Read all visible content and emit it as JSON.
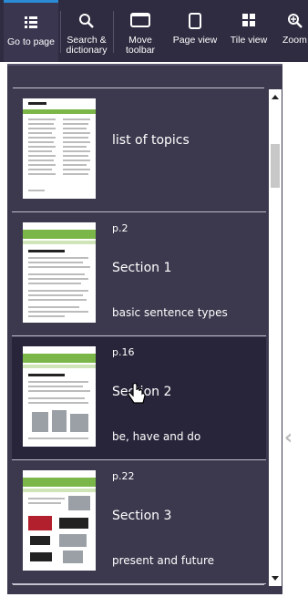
{
  "toolbar": {
    "items": [
      {
        "label_line1": "Go to page",
        "label_line2": "",
        "icon": "list-icon"
      },
      {
        "label_line1": "Search &",
        "label_line2": "dictionary",
        "icon": "search-icon"
      },
      {
        "label_line1": "Move",
        "label_line2": "toolbar",
        "icon": "window-icon"
      },
      {
        "label_line1": "Page view",
        "label_line2": "",
        "icon": "page-icon"
      },
      {
        "label_line1": "Tile view",
        "label_line2": "",
        "icon": "grid-icon"
      },
      {
        "label_line1": "Zoom",
        "label_line2": "",
        "icon": "zoom-icon"
      }
    ]
  },
  "pages": {
    "items": [
      {
        "page": "",
        "title": "list of topics",
        "subtitle": ""
      },
      {
        "page": "p.2",
        "title": "Section 1",
        "subtitle": "basic sentence types"
      },
      {
        "page": "p.16",
        "title": "Section 2",
        "subtitle": "be, have and do"
      },
      {
        "page": "p.22",
        "title": "Section 3",
        "subtitle": "present and future"
      }
    ]
  },
  "colors": {
    "toolbar_bg": "#2f2b40",
    "panel_bg": "#3c394e",
    "selected_bg": "#28253a",
    "accent_blue": "#2a8bd6",
    "thumb_green": "#7ab648"
  }
}
